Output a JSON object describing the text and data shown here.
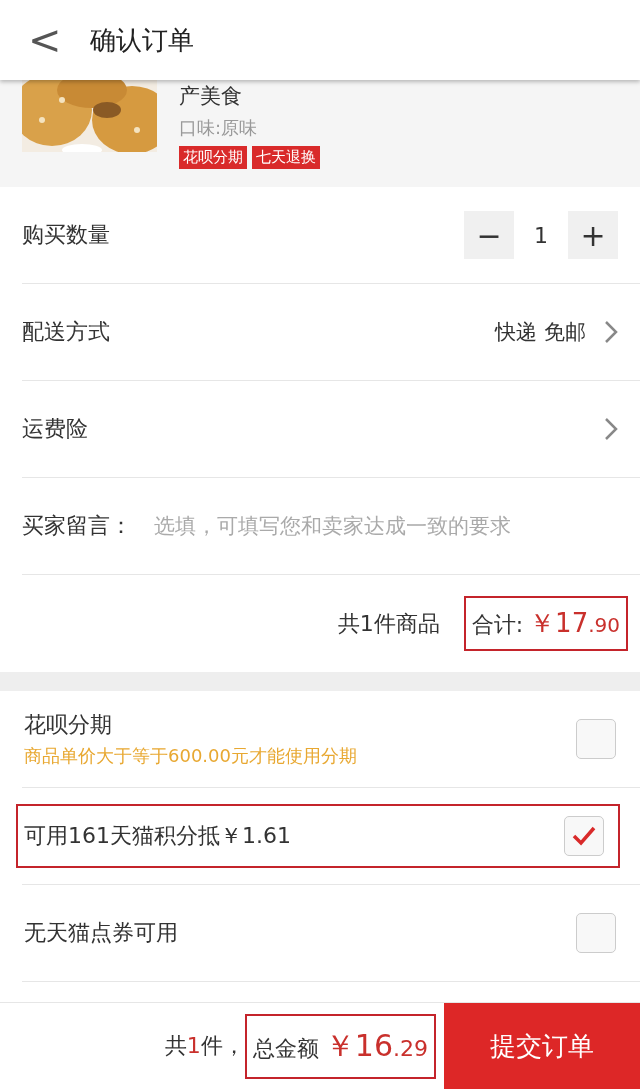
{
  "header": {
    "back": "<",
    "title": "确认订单"
  },
  "product": {
    "kind": "picture",
    "name": "产美食",
    "flavor": "口味:原味",
    "tags": [
      "花呗分期",
      "七天退换"
    ]
  },
  "quantity": {
    "label": "购买数量",
    "minus": "−",
    "value": "1",
    "plus": "+"
  },
  "delivery": {
    "label": "配送方式",
    "value": "快递 免邮"
  },
  "insurance": {
    "label": "运费险"
  },
  "message": {
    "label": "买家留言：",
    "placeholder": "选填，可填写您和卖家达成一致的要求"
  },
  "subtotal": {
    "count": "共1件商品",
    "label": "合计:",
    "currency": "￥",
    "integer": "17",
    "decimal": ".90",
    "highlighted": true
  },
  "options": [
    {
      "title": "花呗分期",
      "note": "商品单价大于等于600.00元才能使用分期",
      "checked": false,
      "highlighted": false
    },
    {
      "title": "可用161天猫积分抵￥1.61",
      "checked": true,
      "highlighted": true
    },
    {
      "title": "无天猫点券可用",
      "checked": false,
      "highlighted": false
    }
  ],
  "footer": {
    "count_prefix": "共",
    "count": "1",
    "count_suffix": "件，",
    "label": "总金额",
    "currency": "￥",
    "integer": "16",
    "decimal": ".29",
    "highlighted": true,
    "submit": "提交订单"
  }
}
